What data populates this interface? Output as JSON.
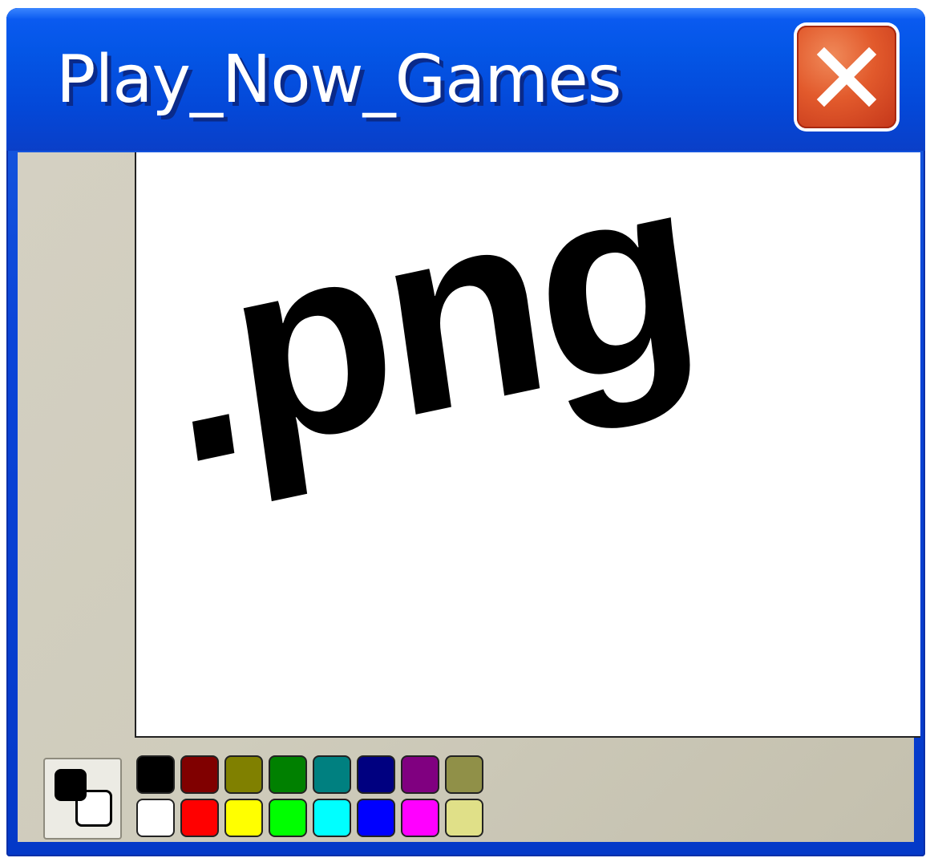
{
  "window": {
    "title": "Play_Now_Games"
  },
  "canvas": {
    "text": ".png"
  },
  "colors": {
    "foreground": "#000000",
    "background": "#ffffff"
  },
  "palette": [
    "#000000",
    "#800000",
    "#808000",
    "#008000",
    "#008080",
    "#000080",
    "#800080",
    "#909048",
    "#ffffff",
    "#ff0000",
    "#ffff00",
    "#00ff00",
    "#00ffff",
    "#0000ff",
    "#ff00ff",
    "#e0e088"
  ],
  "icons": {
    "close": "close-x-icon"
  }
}
